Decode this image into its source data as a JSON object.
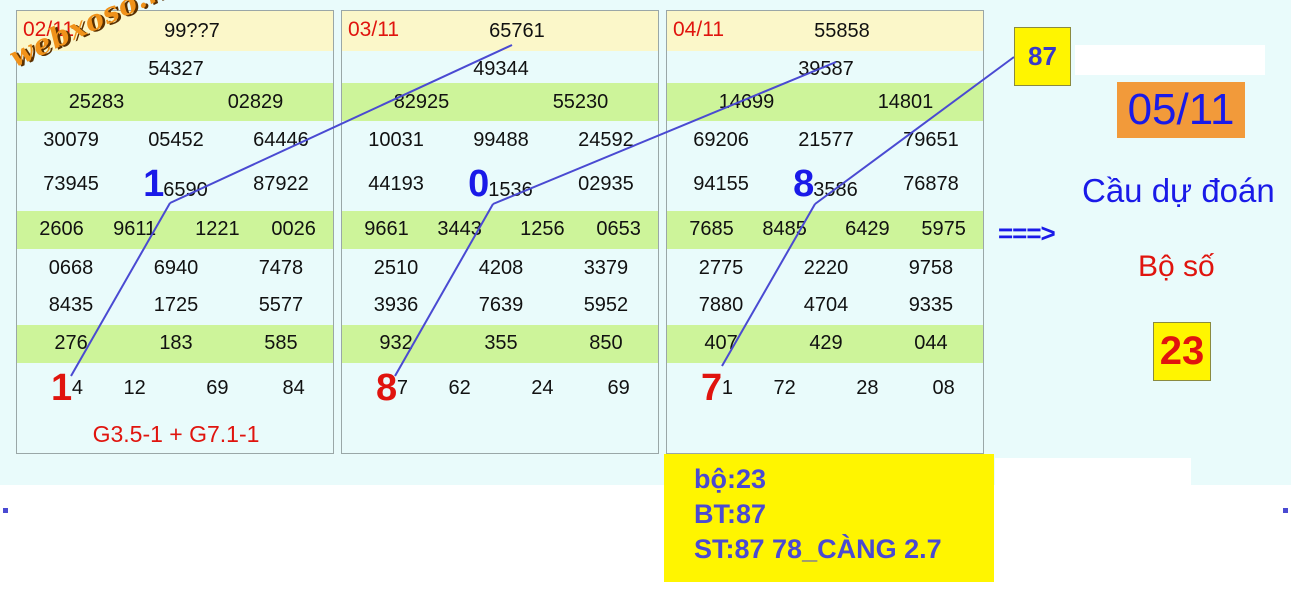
{
  "watermark": "webxoso.net",
  "tables": [
    {
      "date": "02/11",
      "rows": [
        [
          "99??7"
        ],
        [
          "54327"
        ],
        [
          "25283",
          "02829"
        ],
        [
          "30079",
          "05452",
          "64446"
        ],
        [
          "73945",
          "6590",
          "87922"
        ],
        [
          "2606",
          "9611",
          "1221",
          "0026"
        ],
        [
          "0668",
          "6940",
          "7478"
        ],
        [
          "8435",
          "1725",
          "5577"
        ],
        [
          "276",
          "183",
          "585"
        ],
        [
          "4",
          "12",
          "69",
          "84"
        ]
      ],
      "highlight_top": "1",
      "highlight_bottom": "1",
      "note": "G3.5-1 + G7.1-1"
    },
    {
      "date": "03/11",
      "rows": [
        [
          "65761"
        ],
        [
          "49344"
        ],
        [
          "82925",
          "55230"
        ],
        [
          "10031",
          "99488",
          "24592"
        ],
        [
          "44193",
          "1536",
          "02935"
        ],
        [
          "9661",
          "3443",
          "1256",
          "0653"
        ],
        [
          "2510",
          "4208",
          "3379"
        ],
        [
          "3936",
          "7639",
          "5952"
        ],
        [
          "932",
          "355",
          "850"
        ],
        [
          "7",
          "62",
          "24",
          "69"
        ]
      ],
      "highlight_top": "0",
      "highlight_bottom": "8",
      "note": ""
    },
    {
      "date": "04/11",
      "rows": [
        [
          "55858"
        ],
        [
          "39587"
        ],
        [
          "14699",
          "14801"
        ],
        [
          "69206",
          "21577",
          "79651"
        ],
        [
          "94155",
          "3586",
          "76878"
        ],
        [
          "7685",
          "8485",
          "6429",
          "5975"
        ],
        [
          "2775",
          "2220",
          "9758"
        ],
        [
          "7880",
          "4704",
          "9335"
        ],
        [
          "407",
          "429",
          "044"
        ],
        [
          "1",
          "72",
          "28",
          "08"
        ]
      ],
      "highlight_top": "8",
      "highlight_bottom": "7",
      "note": ""
    }
  ],
  "callout_87": "87",
  "prediction": {
    "date": "05/11",
    "title": "Cầu dự đoán",
    "arrow": "===>",
    "set_label": "Bộ số",
    "set_value": "23"
  },
  "summary": {
    "line1": "bộ:23",
    "line2": "BT:87",
    "line3": "ST:87 78_CÀNG 2.7"
  },
  "colors": {
    "red": "#e0140e",
    "blue": "#1a1ae8",
    "green_row": "#cdf49a",
    "header_row": "#fbf7c9",
    "yellow_box": "#fff500",
    "orange_box": "#f29a3a"
  }
}
